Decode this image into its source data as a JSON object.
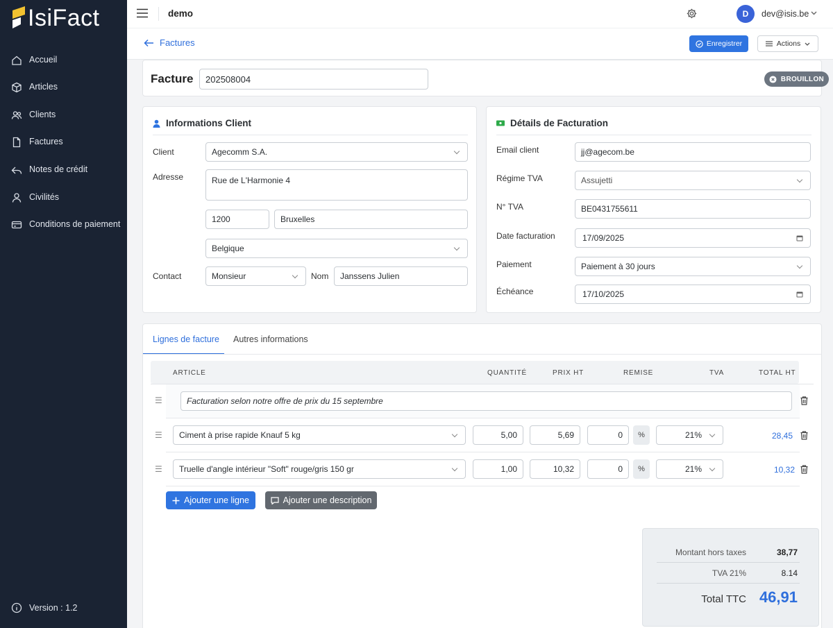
{
  "app": {
    "name": "IsiFact",
    "version_label": "Version : 1.2"
  },
  "sidebar": {
    "items": [
      {
        "label": "Accueil"
      },
      {
        "label": "Articles"
      },
      {
        "label": "Clients"
      },
      {
        "label": "Factures"
      },
      {
        "label": "Notes de crédit"
      },
      {
        "label": "Civilités"
      },
      {
        "label": "Conditions de paiement"
      }
    ]
  },
  "topbar": {
    "tenant": "demo",
    "avatar_initial": "D",
    "user_email": "dev@isis.be"
  },
  "subbar": {
    "back_label": "Factures",
    "save_label": "Enregistrer",
    "actions_label": "Actions"
  },
  "invoice": {
    "title": "Facture",
    "number": "202508004",
    "status": "BROUILLON"
  },
  "client": {
    "section_title": "Informations Client",
    "client_label": "Client",
    "client_value": "Agecomm S.A.",
    "address_label": "Adresse",
    "address_value": "Rue de L'Harmonie 4",
    "postal_code": "1200",
    "city": "Bruxelles",
    "country": "Belgique",
    "contact_label": "Contact",
    "civility": "Monsieur",
    "name_label": "Nom",
    "name_value": "Janssens Julien"
  },
  "billing": {
    "section_title": "Détails de Facturation",
    "email_label": "Email client",
    "email_value": "jj@agecom.be",
    "vat_regime_label": "Régime TVA",
    "vat_regime_value": "Assujetti",
    "vat_number_label": "N° TVA",
    "vat_number_value": "BE0431755611",
    "invoice_date_label": "Date facturation",
    "invoice_date_value": "17/09/2025",
    "payment_label": "Paiement",
    "payment_value": "Paiement à 30 jours",
    "due_label": "Échéance",
    "due_value": "17/10/2025"
  },
  "tabs": {
    "lines": "Lignes de facture",
    "other": "Autres informations"
  },
  "table": {
    "headers": {
      "article": "ARTICLE",
      "quantity": "QUANTITÉ",
      "price": "PRIX HT",
      "discount": "REMISE",
      "vat": "TVA",
      "total": "TOTAL HT"
    },
    "description_line": "Facturation selon notre offre de prix du 15 septembre",
    "rows": [
      {
        "article": "Ciment à prise rapide Knauf 5 kg",
        "quantity": "5,00",
        "price": "5,69",
        "discount": "0",
        "discount_unit": "%",
        "vat": "21%",
        "total": "28,45"
      },
      {
        "article": "Truelle d'angle intérieur \"Soft\" rouge/gris 150 gr",
        "quantity": "1,00",
        "price": "10,32",
        "discount": "0",
        "discount_unit": "%",
        "vat": "21%",
        "total": "10,32"
      }
    ],
    "add_line_label": "Ajouter une ligne",
    "add_description_label": "Ajouter une description"
  },
  "totals": {
    "subtotal_label": "Montant hors taxes",
    "subtotal_value": "38,77",
    "vat_label": "TVA 21%",
    "vat_value": "8.14",
    "total_label": "Total TTC",
    "total_value": "46,91"
  },
  "colors": {
    "sidebar_bg": "#1a2333",
    "accent": "#2f74e0",
    "status_badge": "#6c7580",
    "total_highlight": "#2f6fdc"
  }
}
